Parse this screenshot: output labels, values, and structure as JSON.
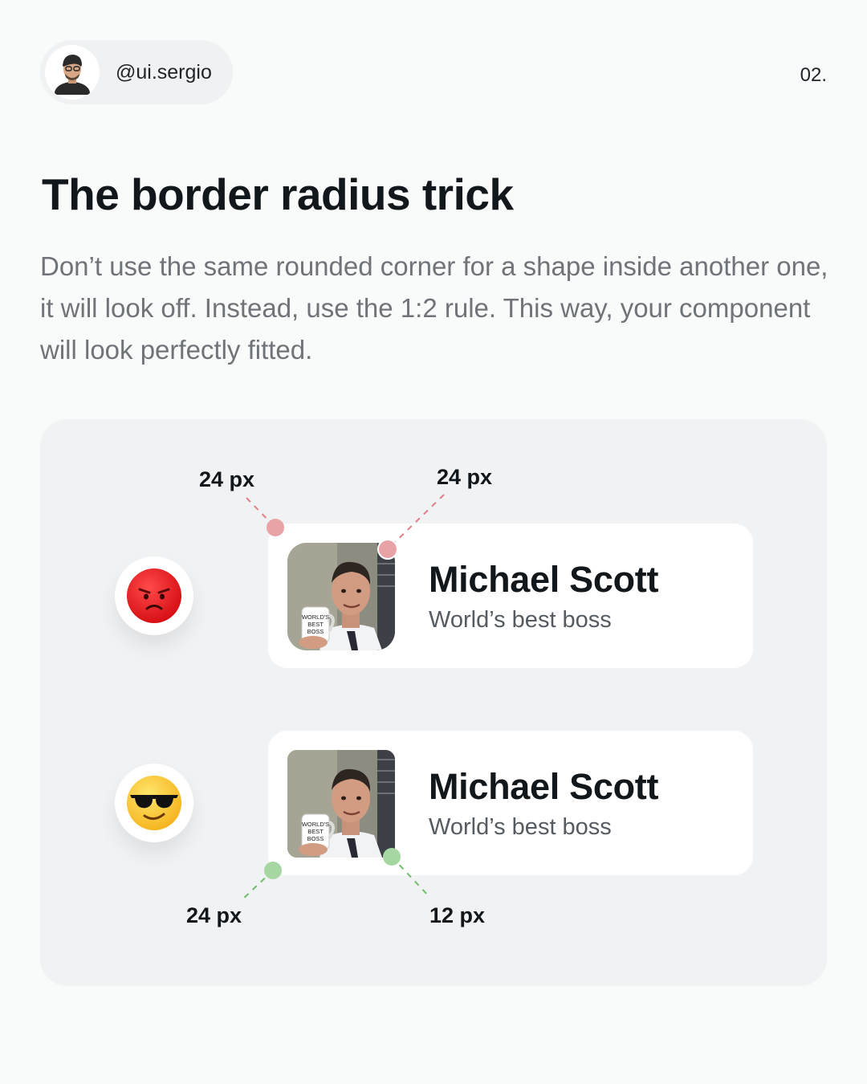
{
  "header": {
    "handle": "@ui.sergio",
    "page_number": "02."
  },
  "title": "The border radius trick",
  "intro": "Don’t use the same rounded corner for a shape inside another one, it will look off. Instead, use the 1:2 rule. This way, your component will look perfectly fitted.",
  "examples": [
    {
      "verdict_icon": "angry-face-emoji",
      "name": "Michael Scott",
      "role": "World’s best boss",
      "mug_text": [
        "WORLD'S",
        "BEST",
        "BOSS"
      ],
      "outer_label": "24 px",
      "inner_label": "24 px",
      "marker_color": "#e8a3a6"
    },
    {
      "verdict_icon": "sunglasses-face-emoji",
      "name": "Michael Scott",
      "role": "World’s best boss",
      "mug_text": [
        "WORLD'S",
        "BEST",
        "BOSS"
      ],
      "outer_label": "24 px",
      "inner_label": "12 px",
      "marker_color": "#a6d6a2"
    }
  ]
}
